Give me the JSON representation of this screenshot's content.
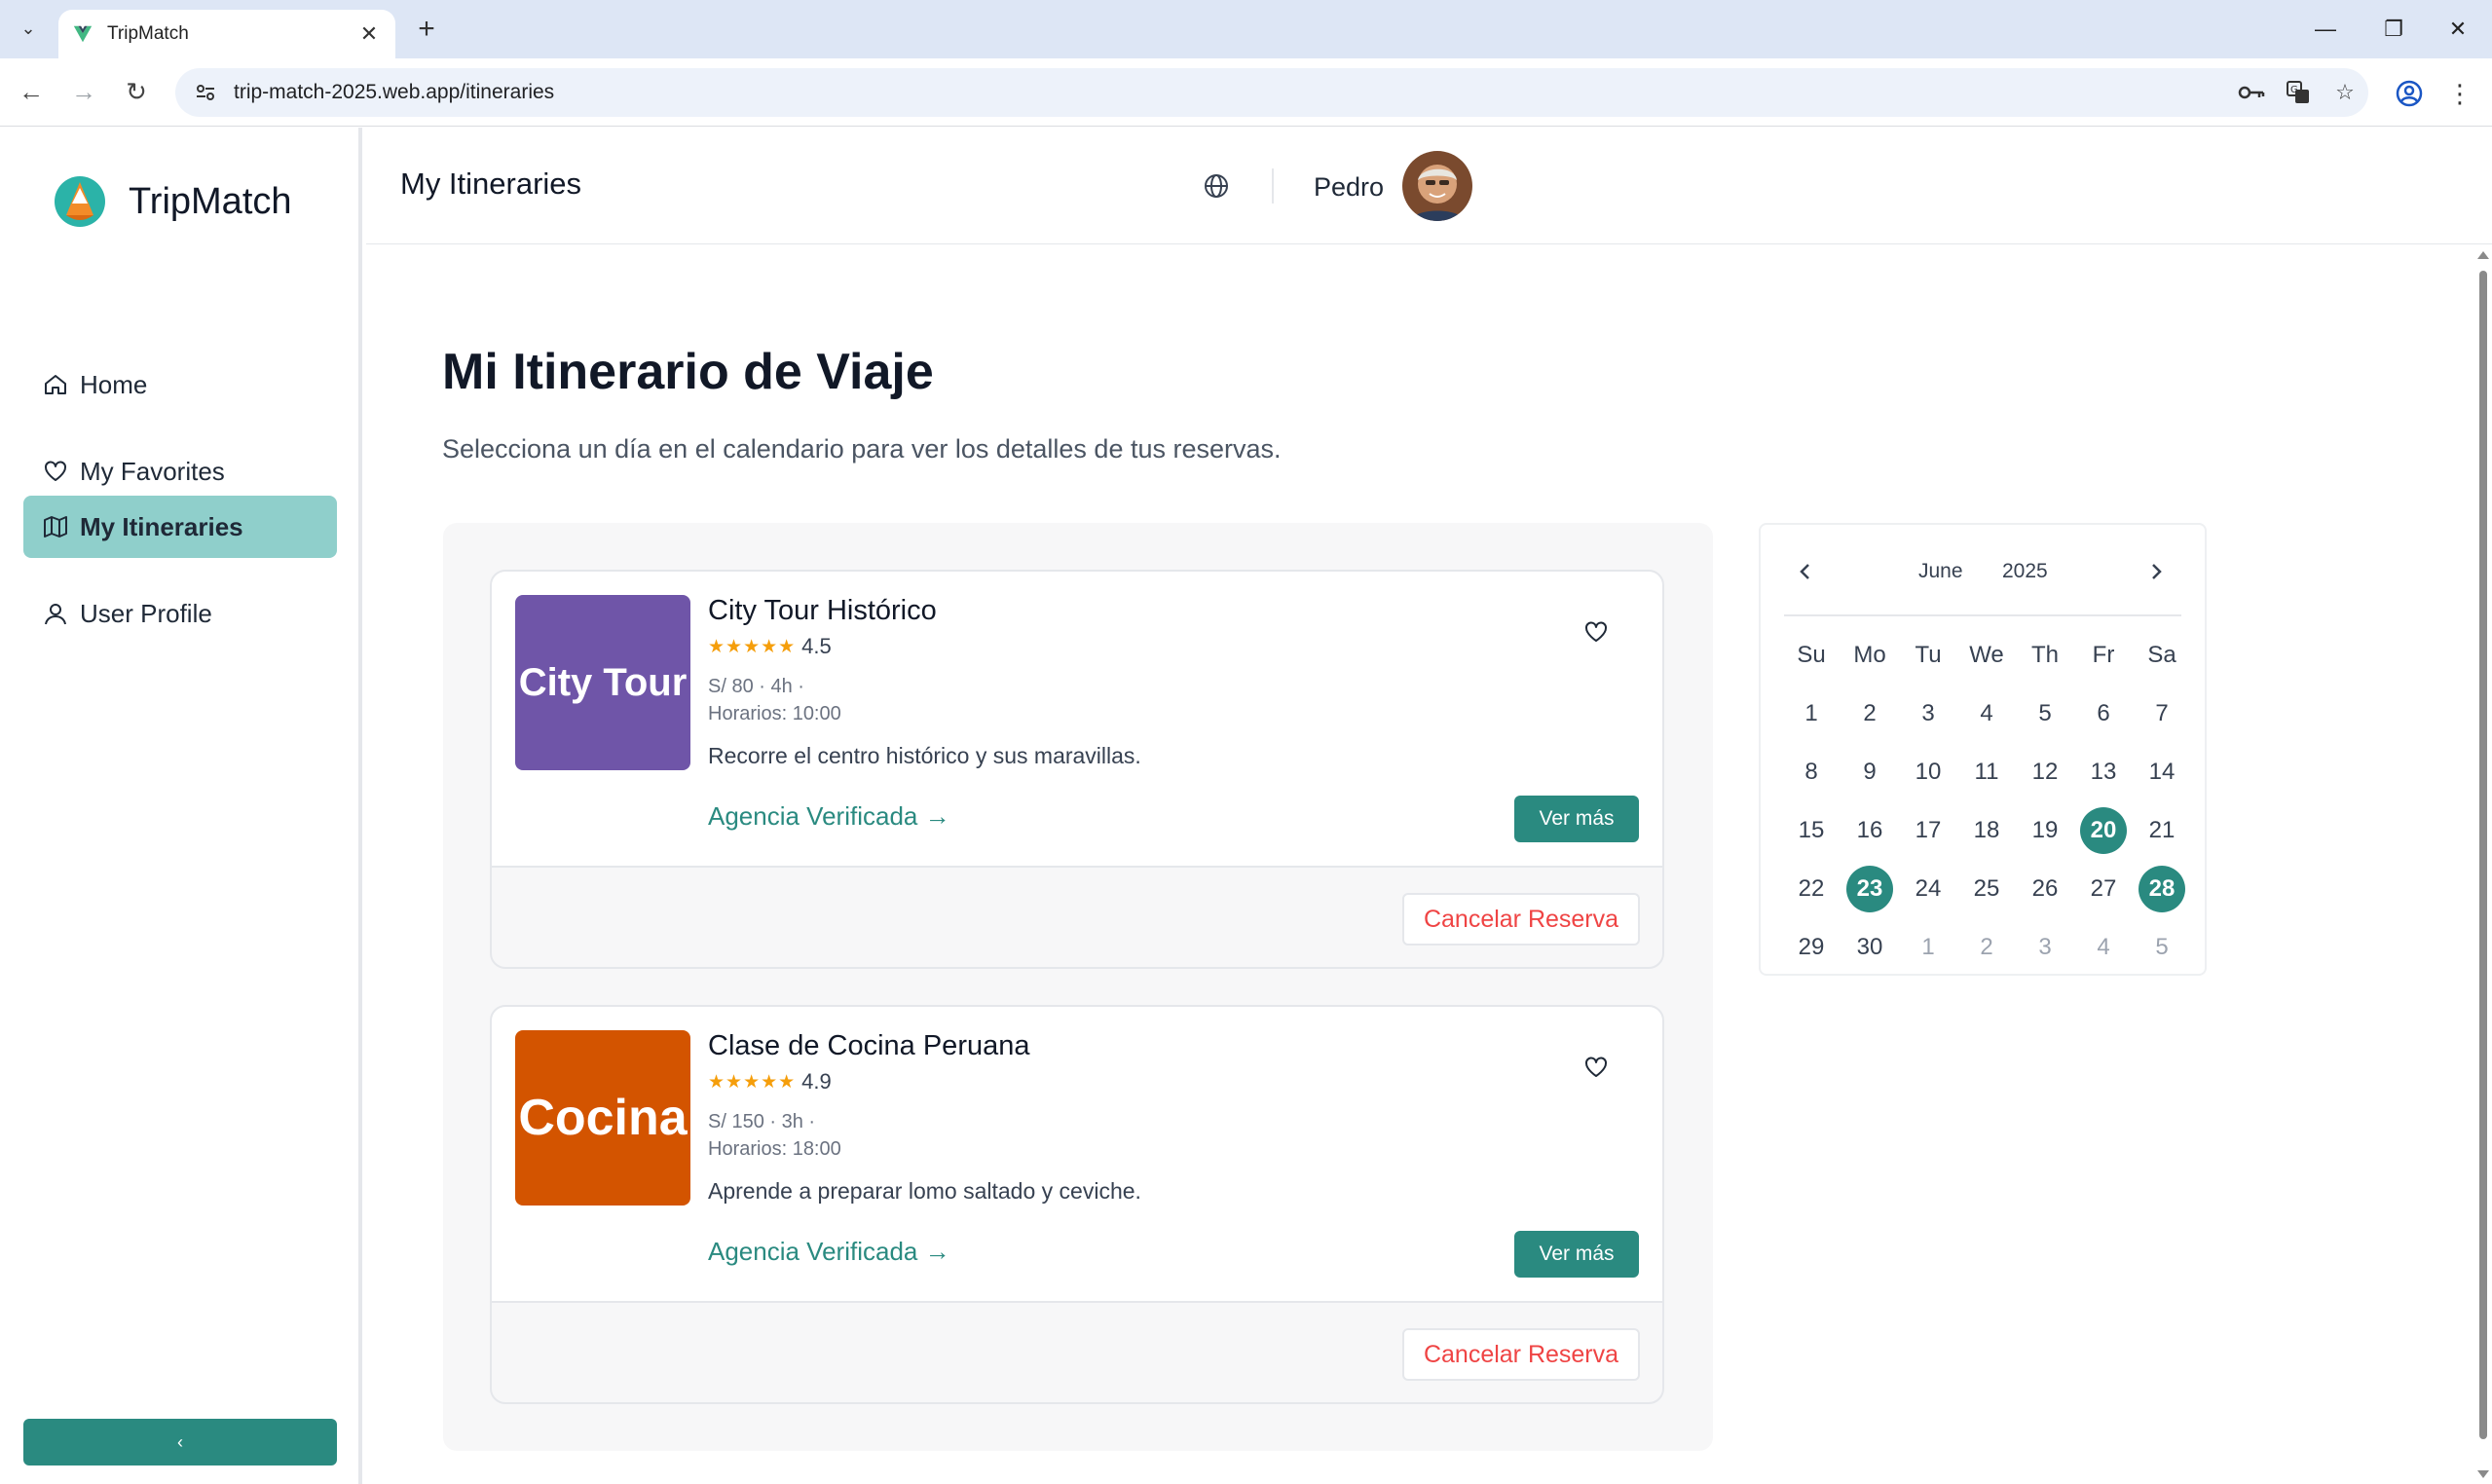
{
  "browser": {
    "tab_title": "TripMatch",
    "url": "trip-match-2025.web.app/itineraries"
  },
  "sidebar": {
    "brand": "TripMatch",
    "items": [
      {
        "label": "Home",
        "icon": "home-icon"
      },
      {
        "label": "My Favorites",
        "icon": "heart-icon"
      },
      {
        "label": "My Itineraries",
        "icon": "map-icon",
        "active": true
      },
      {
        "label": "User Profile",
        "icon": "user-icon"
      }
    ],
    "collapse_label": "‹"
  },
  "topbar": {
    "title": "My Itineraries",
    "user_name": "Pedro"
  },
  "main": {
    "heading": "Mi Itinerario de Viaje",
    "subtitle": "Selecciona un día en el calendario para ver los detalles de tus reservas.",
    "bookings": [
      {
        "thumb_label": "City Tour",
        "thumb_color": "#6f55a8",
        "title": "City Tour Histórico",
        "stars": "★★★★★",
        "rating": "4.5",
        "price_line": "S/ 80 · 4h ·",
        "schedule": "Horarios: 10:00",
        "description": "Recorre el centro histórico y sus maravillas.",
        "agency_link": "Agencia Verificada →",
        "more_label": "Ver más",
        "cancel_label": "Cancelar Reserva"
      },
      {
        "thumb_label": "Cocina",
        "thumb_color": "#d35400",
        "title": "Clase de Cocina Peruana",
        "stars": "★★★★★",
        "rating": "4.9",
        "price_line": "S/ 150 · 3h ·",
        "schedule": "Horarios: 18:00",
        "description": "Aprende a preparar lomo saltado y ceviche.",
        "agency_link": "Agencia Verificada →",
        "more_label": "Ver más",
        "cancel_label": "Cancelar Reserva"
      }
    ]
  },
  "calendar": {
    "month": "June",
    "year": "2025",
    "weekdays": [
      "Su",
      "Mo",
      "Tu",
      "We",
      "Th",
      "Fr",
      "Sa"
    ],
    "days": [
      {
        "d": "1"
      },
      {
        "d": "2"
      },
      {
        "d": "3"
      },
      {
        "d": "4"
      },
      {
        "d": "5"
      },
      {
        "d": "6"
      },
      {
        "d": "7"
      },
      {
        "d": "8"
      },
      {
        "d": "9"
      },
      {
        "d": "10"
      },
      {
        "d": "11"
      },
      {
        "d": "12"
      },
      {
        "d": "13"
      },
      {
        "d": "14"
      },
      {
        "d": "15"
      },
      {
        "d": "16"
      },
      {
        "d": "17"
      },
      {
        "d": "18"
      },
      {
        "d": "19"
      },
      {
        "d": "20",
        "booked": true
      },
      {
        "d": "21"
      },
      {
        "d": "22"
      },
      {
        "d": "23",
        "booked": true
      },
      {
        "d": "24"
      },
      {
        "d": "25"
      },
      {
        "d": "26"
      },
      {
        "d": "27"
      },
      {
        "d": "28",
        "booked": true
      },
      {
        "d": "29"
      },
      {
        "d": "30"
      },
      {
        "d": "1",
        "muted": true
      },
      {
        "d": "2",
        "muted": true
      },
      {
        "d": "3",
        "muted": true
      },
      {
        "d": "4",
        "muted": true
      },
      {
        "d": "5",
        "muted": true
      }
    ]
  },
  "colors": {
    "accent": "#2a8a80",
    "active_nav": "#8fcfcb",
    "danger": "#ef4444"
  }
}
